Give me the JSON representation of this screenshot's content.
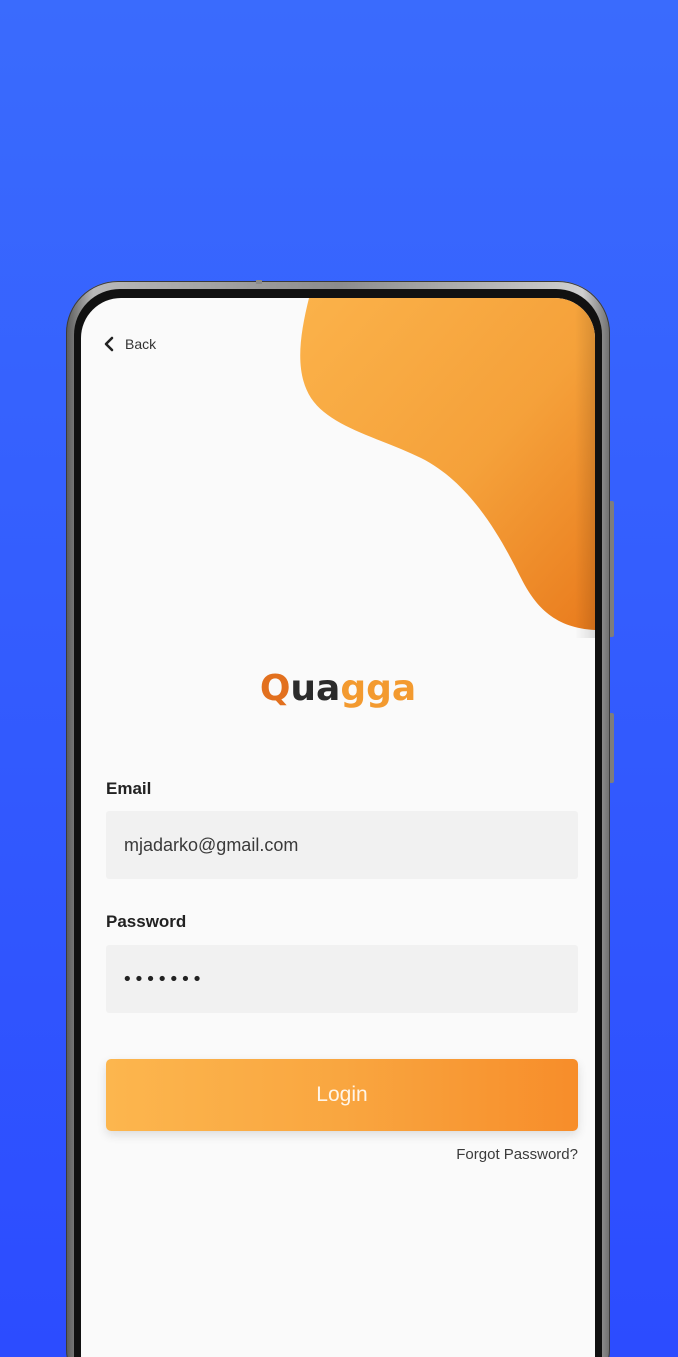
{
  "colors": {
    "background_top": "#3a6bfd",
    "background_bottom": "#2c4cff",
    "accent_orange": "#f39a2f",
    "accent_orange_dark": "#e2701e",
    "screen_bg": "#fafafa",
    "field_bg": "#f1f1f1"
  },
  "nav": {
    "back_icon": "chevron-left-icon",
    "back_label": "Back"
  },
  "brand": {
    "part1": "Q",
    "part2": "ua",
    "part3": "gga"
  },
  "form": {
    "email_label": "Email",
    "email_value": "mjadarko@gmail.com",
    "password_label": "Password",
    "password_masked": "•••••••",
    "login_label": "Login",
    "forgot_label": "Forgot Password?"
  }
}
